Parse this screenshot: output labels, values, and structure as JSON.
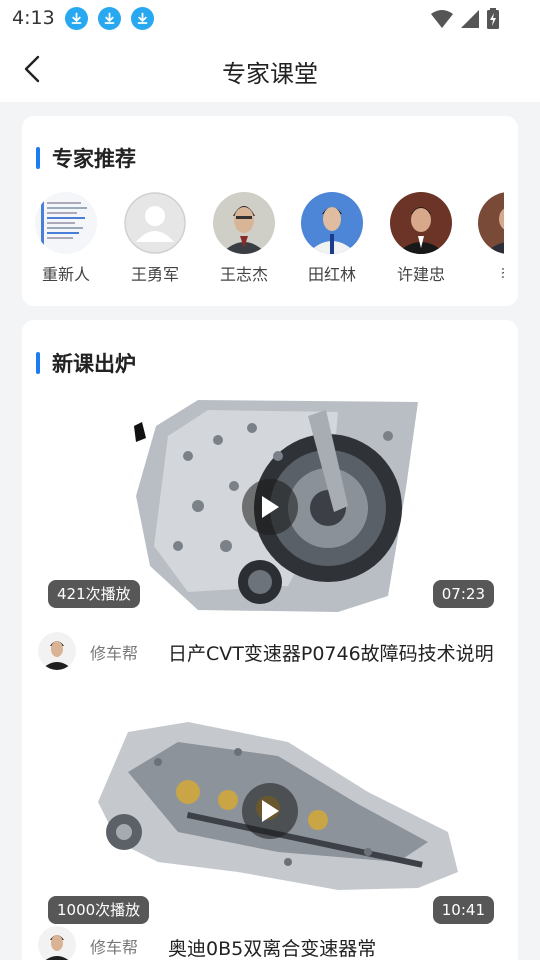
{
  "status_bar": {
    "time": "4:13",
    "icons": [
      "download-icon",
      "download-icon",
      "download-icon",
      "wifi-icon",
      "signal-icon",
      "battery-charging-icon"
    ]
  },
  "header": {
    "title": "专家课堂",
    "back_icon": "chevron-left-icon"
  },
  "experts": {
    "section_title": "专家推荐",
    "items": [
      {
        "name": "重新人"
      },
      {
        "name": "王勇军"
      },
      {
        "name": "王志杰"
      },
      {
        "name": "田红林"
      },
      {
        "name": "许建忠"
      },
      {
        "name": "李"
      }
    ]
  },
  "courses": {
    "section_title": "新课出炉",
    "items": [
      {
        "plays": "421次播放",
        "duration": "07:23",
        "author": "修车帮",
        "title": "日产CVT变速器P0746故障码技术说明"
      },
      {
        "plays": "1000次播放",
        "duration": "10:41",
        "author": "修车帮",
        "title": "奥迪0B5双离合变速器常"
      }
    ]
  },
  "colors": {
    "accent": "#1e7cf2",
    "download_icon": "#27a8f0",
    "background": "#f3f4f6",
    "card": "#ffffff"
  }
}
